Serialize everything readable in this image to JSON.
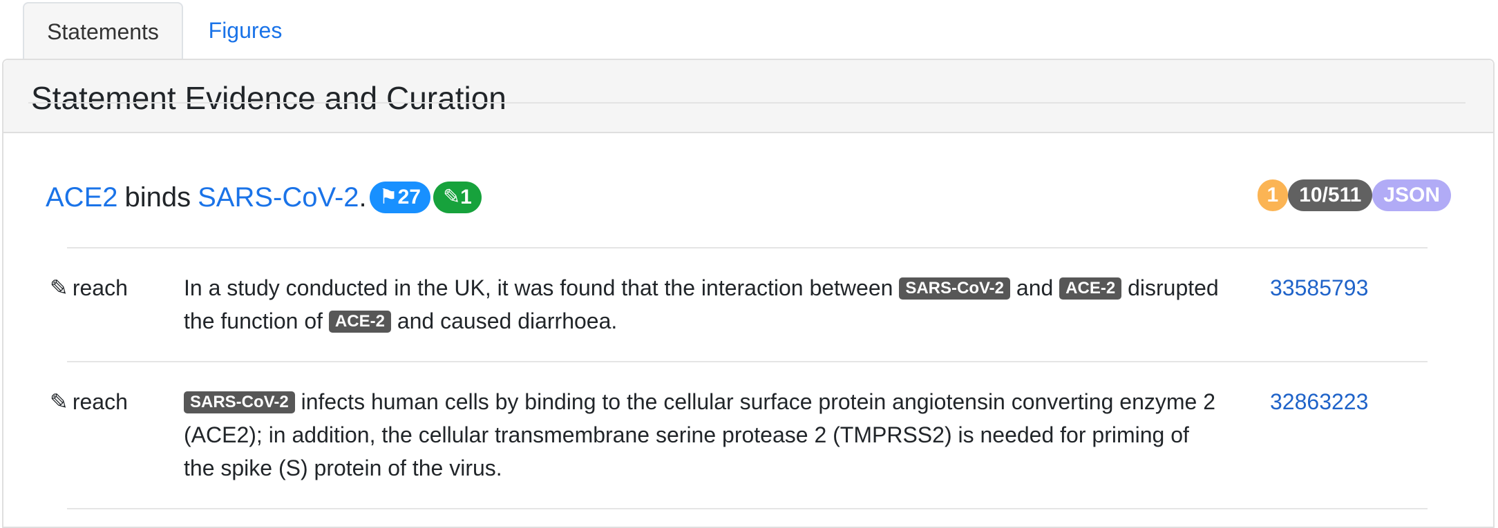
{
  "tabs": [
    {
      "label": "Statements",
      "active": true
    },
    {
      "label": "Figures",
      "active": false
    }
  ],
  "card": {
    "title": "Statement Evidence and Curation"
  },
  "statement": {
    "subject": "ACE2",
    "verb": "binds",
    "object": "SARS-CoV-2",
    "punct": ".",
    "flag_count": "⚑27",
    "edit_count": "✎1",
    "badges": {
      "count": "1",
      "evidence": "10/511",
      "json": "JSON"
    }
  },
  "evidence": [
    {
      "source": "reach",
      "pmid": "33585793",
      "segments": {
        "t1": "In a study conducted in the UK, it was found that the interaction between ",
        "tag1": "SARS-CoV-2",
        "t2": " and ",
        "tag2": "ACE-2",
        "t3": " disrupted the function of ",
        "tag3": "ACE-2",
        "t4": " and caused diarrhoea."
      }
    },
    {
      "source": "reach",
      "pmid": "32863223",
      "segments": {
        "tag1": "SARS-CoV-2",
        "t1": " infects human cells by binding to the cellular surface protein angiotensin converting enzyme 2 (ACE2); in addition, the cellular transmembrane serine protease 2 (TMPRSS2) is needed for priming of the spike (S) protein of the virus."
      }
    }
  ],
  "colors": {
    "link": "#1a73e8",
    "flag_pill": "#1890ff",
    "edit_pill": "#17a23c",
    "badge_orange": "#fbb454",
    "badge_gray": "#616161",
    "badge_lilac": "#b1abf6",
    "tag": "#575757"
  },
  "icons": {
    "evidence_source": "pencil-icon"
  }
}
